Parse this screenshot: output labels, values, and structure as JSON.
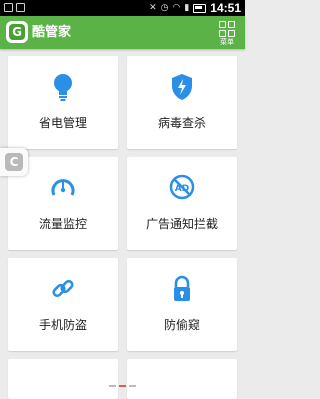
{
  "statusbar": {
    "time": "14:51"
  },
  "app": {
    "title": "酷管家",
    "logo_letter": "G",
    "menu_label": "菜单"
  },
  "tiles": [
    {
      "label": "省电管理",
      "icon": "bulb-icon"
    },
    {
      "label": "病毒查杀",
      "icon": "shield-bolt-icon"
    },
    {
      "label": "流量监控",
      "icon": "gauge-icon"
    },
    {
      "label": "广告通知拦截",
      "icon": "ad-block-icon"
    },
    {
      "label": "手机防盗",
      "icon": "link-icon"
    },
    {
      "label": "防偷窥",
      "icon": "lock-icon"
    }
  ],
  "side_handle": {
    "letter": "C"
  },
  "colors": {
    "appbar": "#5bb347",
    "icon_blue": "#2b8fe8",
    "pager_active": "#e05b4a"
  }
}
